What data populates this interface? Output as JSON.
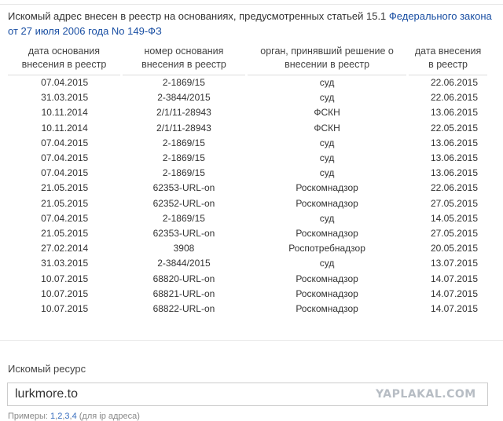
{
  "intro": {
    "text": "Искомый адрес внесен в реестр на основаниях, предусмотренных статьей 15.1 ",
    "link": "Федерального закона от 27 июля 2006 года No 149-ФЗ"
  },
  "table": {
    "headers": [
      "дата основания внесения в реестр",
      "номер основания внесения в реестр",
      "орган, принявший решение о внесении в реестр",
      "дата внесения в реестр"
    ],
    "rows": [
      [
        "07.04.2015",
        "2-1869/15",
        "суд",
        "22.06.2015"
      ],
      [
        "31.03.2015",
        "2-3844/2015",
        "суд",
        "22.06.2015"
      ],
      [
        "10.11.2014",
        "2/1/11-28943",
        "ФСКН",
        "13.06.2015"
      ],
      [
        "10.11.2014",
        "2/1/11-28943",
        "ФСКН",
        "22.05.2015"
      ],
      [
        "07.04.2015",
        "2-1869/15",
        "суд",
        "13.06.2015"
      ],
      [
        "07.04.2015",
        "2-1869/15",
        "суд",
        "13.06.2015"
      ],
      [
        "07.04.2015",
        "2-1869/15",
        "суд",
        "13.06.2015"
      ],
      [
        "21.05.2015",
        "62353-URL-on",
        "Роскомнадзор",
        "22.06.2015"
      ],
      [
        "21.05.2015",
        "62352-URL-on",
        "Роскомнадзор",
        "27.05.2015"
      ],
      [
        "07.04.2015",
        "2-1869/15",
        "суд",
        "14.05.2015"
      ],
      [
        "21.05.2015",
        "62353-URL-on",
        "Роскомнадзор",
        "27.05.2015"
      ],
      [
        "27.02.2014",
        "3908",
        "Роспотребнадзор",
        "20.05.2015"
      ],
      [
        "31.03.2015",
        "2-3844/2015",
        "суд",
        "13.07.2015"
      ],
      [
        "10.07.2015",
        "68820-URL-on",
        "Роскомнадзор",
        "14.07.2015"
      ],
      [
        "10.07.2015",
        "68821-URL-on",
        "Роскомнадзор",
        "14.07.2015"
      ],
      [
        "10.07.2015",
        "68822-URL-on",
        "Роскомнадзор",
        "14.07.2015"
      ]
    ]
  },
  "resource": {
    "label": "Искомый ресурс",
    "value": "lurkmore.to"
  },
  "watermark": "YAPLAKAL.COM",
  "examples": {
    "label": "Примеры:",
    "links": [
      "1",
      "2",
      "3",
      "4"
    ],
    "note": "(для ip адреса)"
  }
}
